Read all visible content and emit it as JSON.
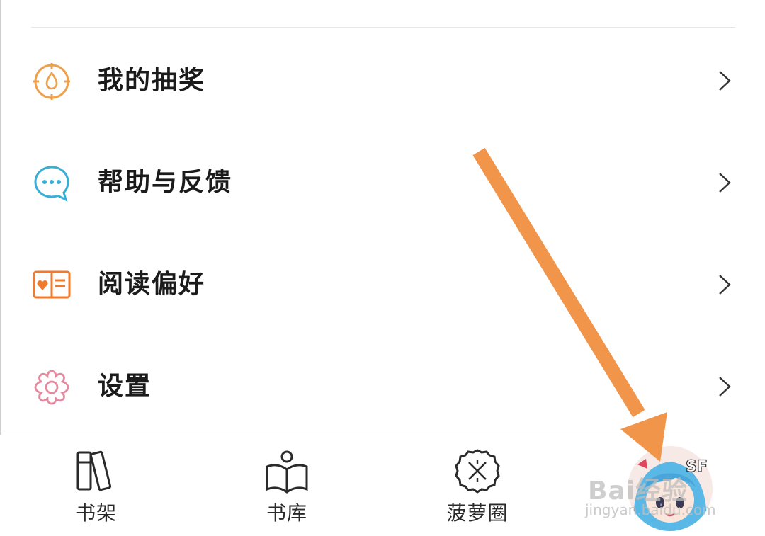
{
  "menu": {
    "items": [
      {
        "label": "我的抽奖",
        "icon": "lottery-icon"
      },
      {
        "label": "帮助与反馈",
        "icon": "chat-bubble-icon"
      },
      {
        "label": "阅读偏好",
        "icon": "open-book-heart-icon"
      },
      {
        "label": "设置",
        "icon": "settings-flower-icon"
      }
    ]
  },
  "tabbar": {
    "tabs": [
      {
        "label": "书架",
        "icon": "bookshelf-icon"
      },
      {
        "label": "书库",
        "icon": "library-reader-icon"
      },
      {
        "label": "菠萝圈",
        "icon": "pineapple-circle-icon"
      },
      {
        "label": "",
        "icon": "avatar-icon"
      }
    ]
  },
  "overlay": {
    "watermark": "Bai经验",
    "watermark_url": "jingyan.baidu.com",
    "avatar_badge": "SF",
    "arrow_color": "#F0954A"
  },
  "colors": {
    "lottery": "#F0A04B",
    "help": "#3AAFD6",
    "preference": "#F07A2E",
    "settings": "#E58A9E"
  }
}
